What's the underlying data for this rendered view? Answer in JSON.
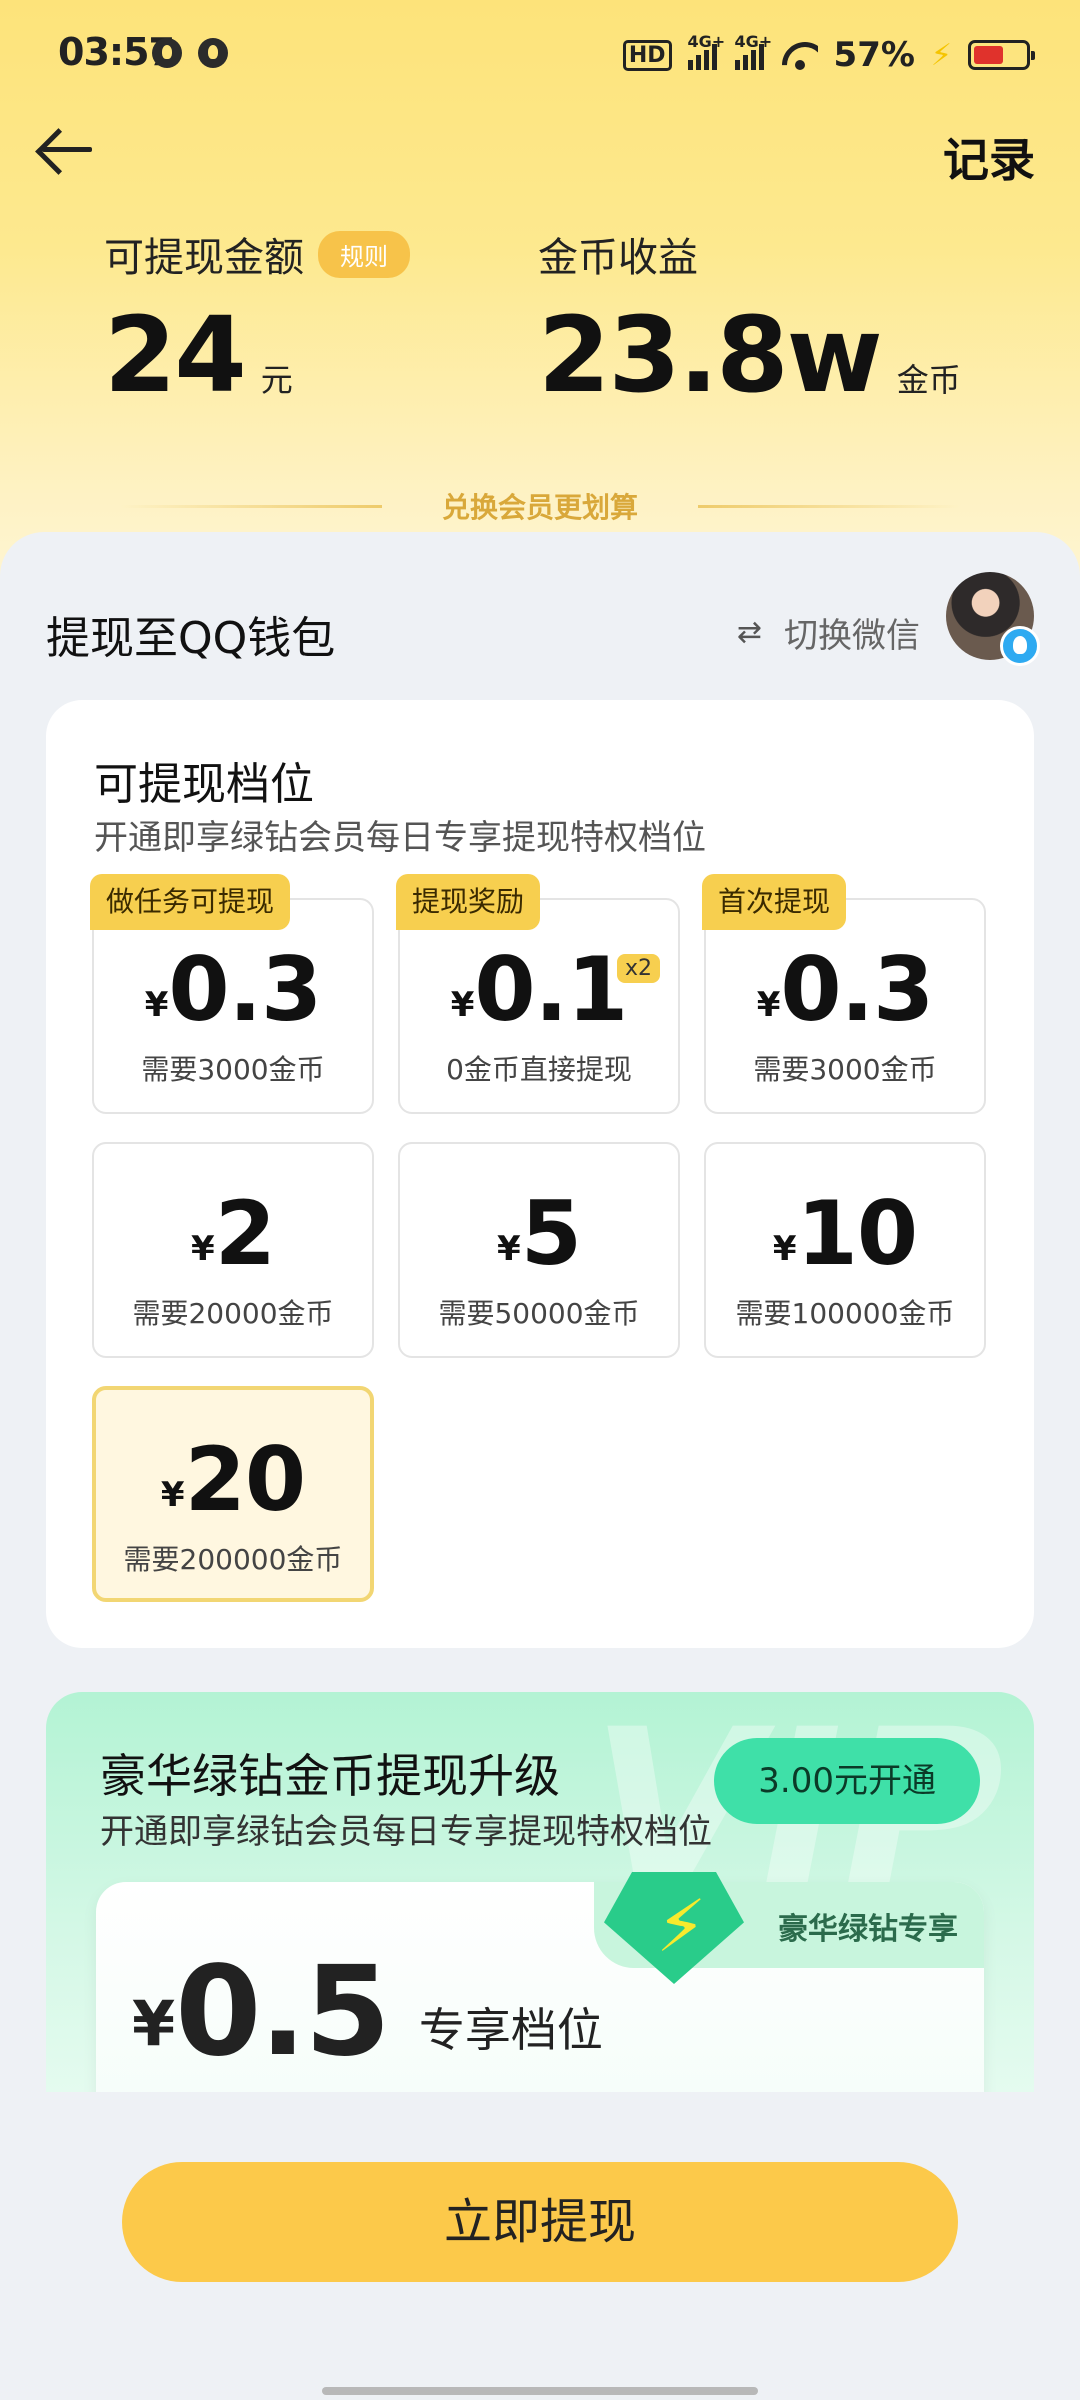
{
  "status_bar": {
    "time": "03:57",
    "hd": "HD",
    "network1": "4G+",
    "network2": "4G+",
    "battery_pct": "57%",
    "battery_level": 0.57,
    "icons": [
      "notification-dot-icon",
      "notification-dot-icon",
      "signal-icon",
      "wifi-icon",
      "charging-icon",
      "battery-icon"
    ]
  },
  "header": {
    "back_icon": "arrow-left-icon",
    "record_label": "记录"
  },
  "balance": {
    "withdrawable_label": "可提现金额",
    "rule_badge": "规则",
    "withdrawable_value": "24",
    "withdrawable_unit": "元",
    "coin_label": "金币收益",
    "coin_value": "23.8w",
    "coin_unit": "金币"
  },
  "exchange_hint": "兑换会员更划算",
  "wallet": {
    "title": "提现至QQ钱包",
    "switch_icon": "swap-icon",
    "switch_label": "切换微信"
  },
  "tiers_section": {
    "title": "可提现档位",
    "subtitle": "开通即享绿钻会员每日专享提现特权档位",
    "tiers": [
      {
        "tag": "做任务可提现",
        "currency": "¥",
        "amount": "0.3",
        "requirement": "需要3000金币"
      },
      {
        "tag": "提现奖励",
        "currency": "¥",
        "amount": "0.1",
        "multiplier": "x2",
        "requirement": "0金币直接提现"
      },
      {
        "tag": "首次提现",
        "currency": "¥",
        "amount": "0.3",
        "requirement": "需要3000金币"
      },
      {
        "currency": "¥",
        "amount": "2",
        "requirement": "需要20000金币"
      },
      {
        "currency": "¥",
        "amount": "5",
        "requirement": "需要50000金币"
      },
      {
        "currency": "¥",
        "amount": "10",
        "requirement": "需要100000金币"
      },
      {
        "currency": "¥",
        "amount": "20",
        "requirement": "需要200000金币",
        "selected": true
      }
    ]
  },
  "vip": {
    "title": "豪华绿钻金币提现升级",
    "subtitle": "开通即享绿钻会员每日专享提现特权档位",
    "open_button": "3.00元开通",
    "watermark": "VIP",
    "ribbon": "豪华绿钻专享",
    "gem_icon": "lightning-gem-icon",
    "currency": "¥",
    "amount": "0.5",
    "tier_label": "专享档位",
    "accent": "#3fe0a8"
  },
  "withdraw_button": "立即提现",
  "colors": {
    "brand_yellow": "#fcc94a",
    "tag_yellow": "#f7cf4f",
    "vip_green": "#3fe0a8"
  }
}
